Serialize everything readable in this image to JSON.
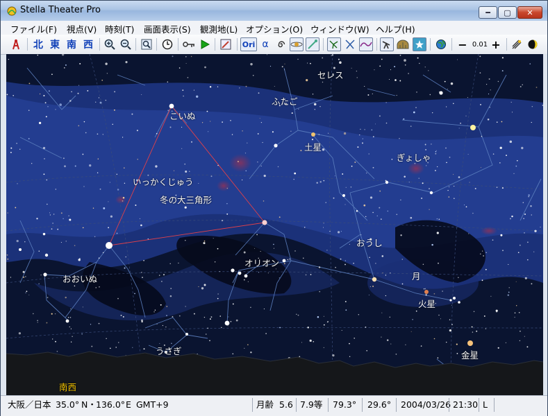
{
  "window": {
    "title": "Stella Theater Pro",
    "min_label": "━",
    "max_label": "▢",
    "close_label": "✕"
  },
  "menu": [
    {
      "label": "ファイル(F)"
    },
    {
      "label": "視点(V)"
    },
    {
      "label": "時刻(T)"
    },
    {
      "label": "画面表示(S)"
    },
    {
      "label": "観測地(L)"
    },
    {
      "label": "オプション(O)"
    },
    {
      "label": "ウィンドウ(W)"
    },
    {
      "label": "ヘルプ(H)"
    }
  ],
  "toolbar": {
    "dir_north": "北",
    "dir_east": "東",
    "dir_south": "南",
    "dir_west": "西",
    "ori_label": "Ori",
    "alpha_label": "α",
    "zoom_step": "0.01",
    "minus": "−",
    "plus": "+"
  },
  "sky_labels": {
    "ceres": "セレス",
    "gemini": "ふたご",
    "canis_minor": "こいぬ",
    "saturn": "土星",
    "auriga": "ぎょしゃ",
    "monoceros": "いっかくじゅう",
    "winter_triangle": "冬の大三角形",
    "taurus": "おうし",
    "orion": "オリオン",
    "moon": "月",
    "canis_major": "おおいぬ",
    "mars": "火星",
    "lepus": "うさぎ",
    "venus": "金星",
    "southwest": "南西"
  },
  "status": {
    "location": "大阪／日本",
    "lat": "35.0°",
    "lat_dir": "N・",
    "lon": "136.0°",
    "lon_dir": "E",
    "gmt": "GMT+9",
    "moon_age_label": "月齢",
    "moon_age": "5.6",
    "magnitude": "7.9等",
    "fov": "79.3°",
    "alt": "29.6°",
    "date": "2004/03/26",
    "time": "21:30",
    "mode": "L"
  },
  "colors": {
    "sky": "#0a1430",
    "milkyway": "#1f3a8a",
    "ground": "#15171a",
    "triangle": "#e0404a",
    "constellation": "#5c7fbf",
    "horizon_label": "#f2c200"
  }
}
